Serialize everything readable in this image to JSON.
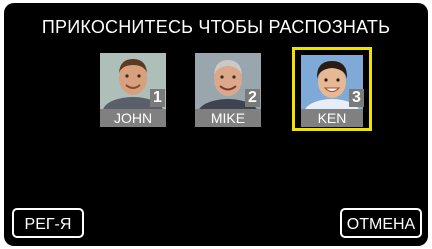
{
  "header": {
    "title": "ПРИКОСНИТЕСЬ ЧТОБЫ РАСПОЗНАТЬ"
  },
  "faces": [
    {
      "number": "1",
      "name": "JOHN",
      "selected": false
    },
    {
      "number": "2",
      "name": "MIKE",
      "selected": false
    },
    {
      "number": "3",
      "name": "KEN",
      "selected": true
    }
  ],
  "buttons": {
    "register_label": "РЕГ-Я",
    "cancel_label": "ОТМЕНА"
  },
  "colors": {
    "background": "#000000",
    "selection": "#f0e300",
    "label_bg": "#808080"
  }
}
